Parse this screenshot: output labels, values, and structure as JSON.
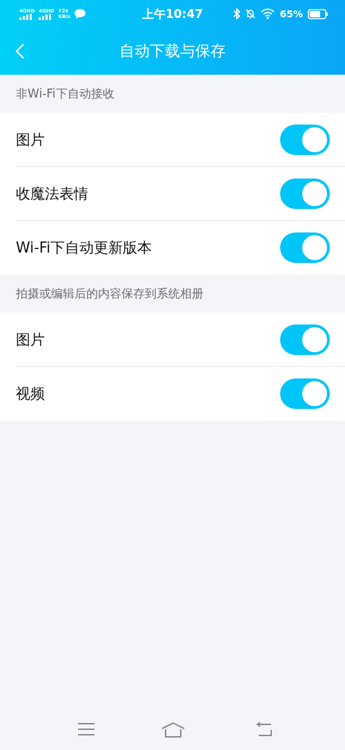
{
  "status_bar": {
    "network_1": "4GHD",
    "network_2": "4GHD",
    "speed_value": "724",
    "speed_unit": "KB/s",
    "time": "上午10:47",
    "battery": "65%"
  },
  "header": {
    "title": "自动下载与保存"
  },
  "sections": [
    {
      "title": "非Wi-Fi下自动接收",
      "items": [
        {
          "label": "图片",
          "on": true
        },
        {
          "label": "收魔法表情",
          "on": true
        },
        {
          "label": "Wi-Fi下自动更新版本",
          "on": true
        }
      ]
    },
    {
      "title": "拍摄或编辑后的内容保存到系统相册",
      "items": [
        {
          "label": "图片",
          "on": true
        },
        {
          "label": "视频",
          "on": true
        }
      ]
    }
  ]
}
